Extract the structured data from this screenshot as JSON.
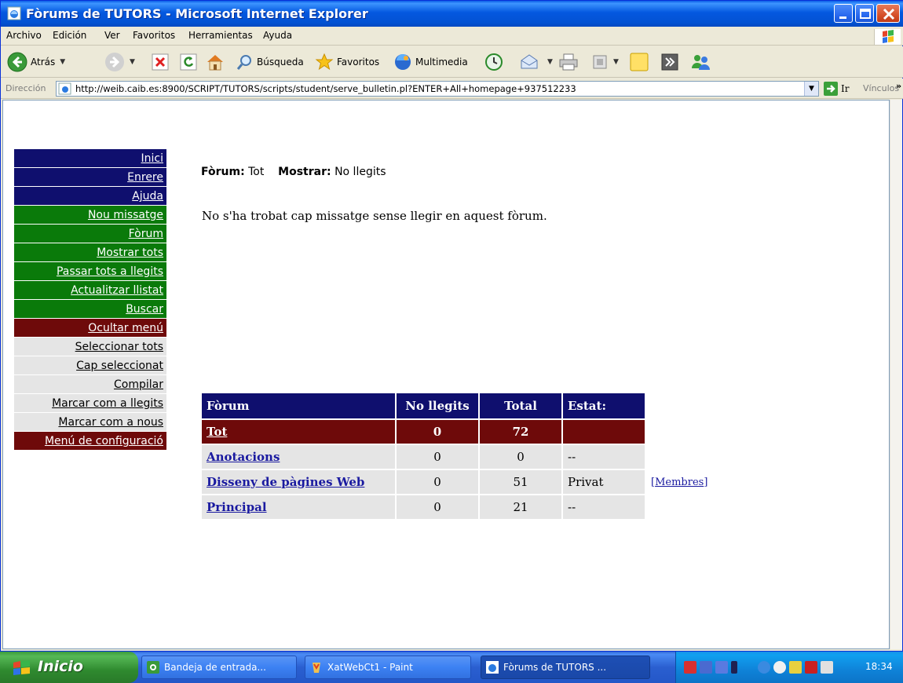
{
  "window": {
    "title": "Fòrums de TUTORS - Microsoft Internet Explorer"
  },
  "menubar": {
    "items": [
      "Archivo",
      "Edición",
      "Ver",
      "Favoritos",
      "Herramientas",
      "Ayuda"
    ]
  },
  "toolbar": {
    "back_label": "Atrás",
    "search_label": "Búsqueda",
    "favorites_label": "Favoritos",
    "media_label": "Multimedia"
  },
  "addressbar": {
    "label": "Dirección",
    "url": "http://weib.caib.es:8900/SCRIPT/TUTORS/scripts/student/serve_bulletin.pl?ENTER+All+homepage+937512233",
    "go_label": "Ir",
    "links_label": "Vínculos",
    "links_more": "»"
  },
  "leftmenu": {
    "items": [
      {
        "label": "Inici",
        "style": "navy"
      },
      {
        "label": "Enrere",
        "style": "navy"
      },
      {
        "label": "Ajuda",
        "style": "navy"
      },
      {
        "label": "Nou missatge",
        "style": "green"
      },
      {
        "label": "Fòrum",
        "style": "green"
      },
      {
        "label": "Mostrar tots",
        "style": "green"
      },
      {
        "label": "Passar tots a llegits",
        "style": "green"
      },
      {
        "label": "Actualitzar llistat",
        "style": "green"
      },
      {
        "label": "Buscar",
        "style": "green"
      },
      {
        "label": "Ocultar menú",
        "style": "maroon"
      },
      {
        "label": "Seleccionar tots",
        "style": "grey"
      },
      {
        "label": "Cap seleccionat",
        "style": "grey"
      },
      {
        "label": "Compilar",
        "style": "grey"
      },
      {
        "label": "Marcar com a llegits",
        "style": "grey"
      },
      {
        "label": "Marcar com a nous",
        "style": "grey"
      },
      {
        "label": "Menú de configuració",
        "style": "maroon"
      }
    ]
  },
  "main": {
    "forum_label": "Fòrum:",
    "forum_value": "Tot",
    "show_label": "Mostrar:",
    "show_value": "No llegits",
    "no_messages": "No s'ha trobat cap missatge sense llegir en aquest fòrum."
  },
  "forum_table": {
    "headers": [
      "Fòrum",
      "No llegits",
      "Total",
      "Estat:"
    ],
    "total_row": {
      "name": "Tot",
      "unread": "0",
      "total": "72",
      "status": ""
    },
    "rows": [
      {
        "name": "Anotacions",
        "unread": "0",
        "total": "0",
        "status": "--",
        "extra": ""
      },
      {
        "name": "Disseny de pàgines Web",
        "unread": "0",
        "total": "51",
        "status": "Privat",
        "extra": "Membres"
      },
      {
        "name": "Principal",
        "unread": "0",
        "total": "21",
        "status": "--",
        "extra": ""
      }
    ]
  },
  "taskbar": {
    "start_label": "Inicio",
    "tasks": [
      {
        "label": "Bandeja de entrada..."
      },
      {
        "label": "XatWebCt1 - Paint"
      },
      {
        "label": "Fòrums de TUTORS ..."
      }
    ],
    "clock": "18:34"
  },
  "colors": {
    "nav_navy": "#0f0f6e",
    "nav_green": "#0a7a0a",
    "nav_maroon": "#6e0a0a",
    "nav_grey": "#e5e5e5",
    "link_blue": "#1a1aa0"
  }
}
